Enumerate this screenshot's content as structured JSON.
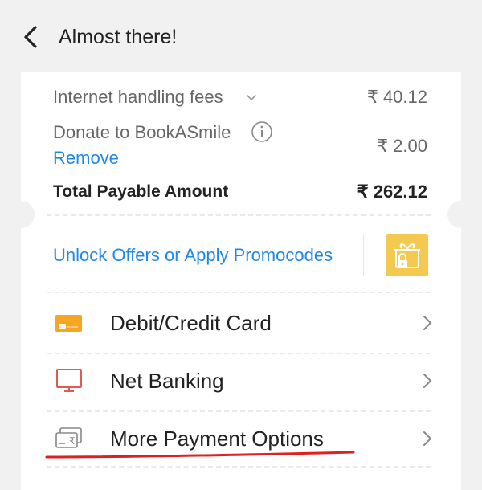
{
  "header": {
    "title": "Almost there!",
    "back_icon": "back-arrow-icon"
  },
  "summary": {
    "fees_label": "Internet handling fees",
    "fees_value": "₹ 40.12",
    "donate_label": "Donate to BookASmile",
    "donate_value": "₹ 2.00",
    "remove_label": "Remove",
    "total_label": "Total Payable Amount",
    "total_value": "₹ 262.12"
  },
  "offers": {
    "label": "Unlock Offers or Apply Promocodes",
    "icon": "gift-lock-icon"
  },
  "payment_options": [
    {
      "label": "Debit/Credit Card",
      "icon": "card-icon"
    },
    {
      "label": "Net Banking",
      "icon": "monitor-icon"
    },
    {
      "label": "More Payment Options",
      "icon": "rupee-notes-icon"
    }
  ],
  "colors": {
    "link": "#1e88e5",
    "card_icon": "#f5a623",
    "netbanking_icon": "#e05a4e",
    "gift_bg": "#f3c94f",
    "underline": "#e0201f"
  }
}
